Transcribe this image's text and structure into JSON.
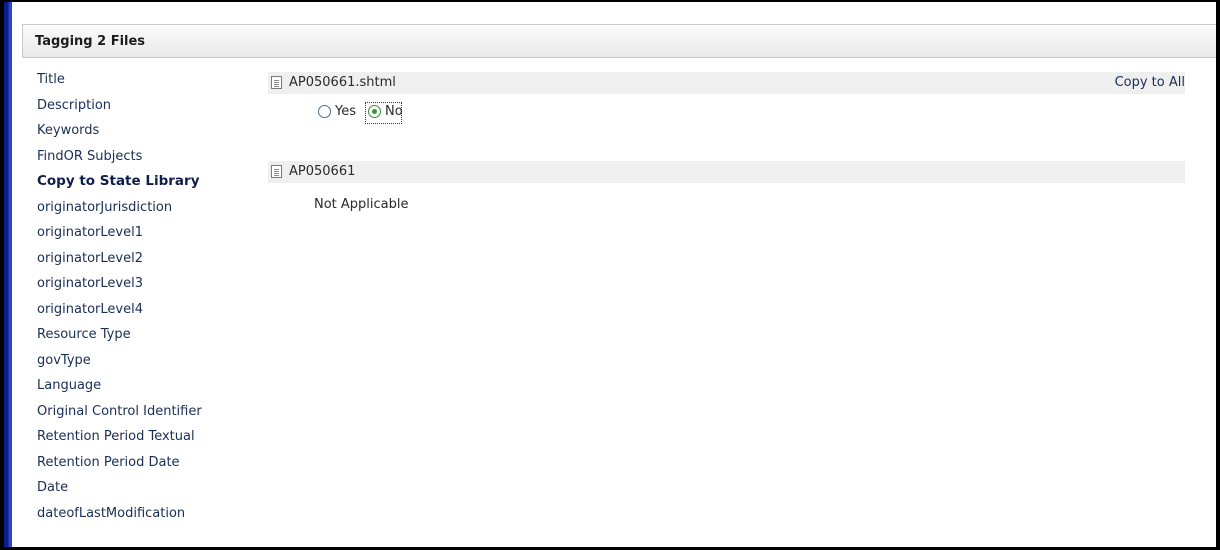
{
  "header": {
    "title": "Tagging 2 Files"
  },
  "fields": [
    "Title",
    "Description",
    "Keywords",
    "FindOR Subjects",
    "Copy to State Library",
    "originatorJurisdiction",
    "originatorLevel1",
    "originatorLevel2",
    "originatorLevel3",
    "originatorLevel4",
    "Resource Type",
    "govType",
    "Language",
    "Original Control Identifier",
    "Retention Period Textual",
    "Retention Period Date",
    "Date",
    "dateofLastModification"
  ],
  "active_field": "Copy to State Library",
  "files": [
    {
      "name": "AP050661.shtml",
      "copy_to_all": "Copy to All",
      "options": {
        "yes": "Yes",
        "no": "No",
        "selected": "No"
      }
    },
    {
      "name": "AP050661",
      "value": "Not Applicable"
    }
  ],
  "icons": {
    "file": "document-icon",
    "radio": "radio-button-icon"
  }
}
